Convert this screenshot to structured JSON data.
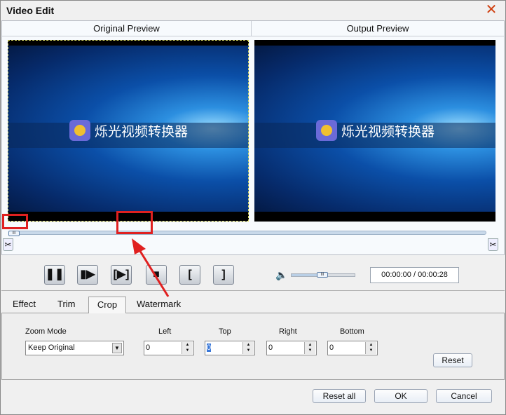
{
  "window": {
    "title": "Video Edit",
    "close_icon": "close-icon"
  },
  "preview": {
    "original_label": "Original Preview",
    "output_label": "Output Preview",
    "video_logo_text": "烁光视频转换器"
  },
  "playback": {
    "time": "00:00:00 / 00:00:28",
    "volume_percent": 50,
    "position_percent": 0
  },
  "tabs": [
    {
      "label": "Effect"
    },
    {
      "label": "Trim"
    },
    {
      "label": "Crop",
      "active": true
    },
    {
      "label": "Watermark"
    }
  ],
  "crop": {
    "zoom_mode_label": "Zoom Mode",
    "zoom_mode_value": "Keep Original",
    "left_label": "Left",
    "left_value": "0",
    "top_label": "Top",
    "top_value": "0",
    "right_label": "Right",
    "right_value": "0",
    "bottom_label": "Bottom",
    "bottom_value": "0",
    "reset_label": "Reset"
  },
  "footer": {
    "reset_all_label": "Reset all",
    "ok_label": "OK",
    "cancel_label": "Cancel"
  },
  "colors": {
    "annotation": "#e02020",
    "accent": "#3a78d8"
  }
}
